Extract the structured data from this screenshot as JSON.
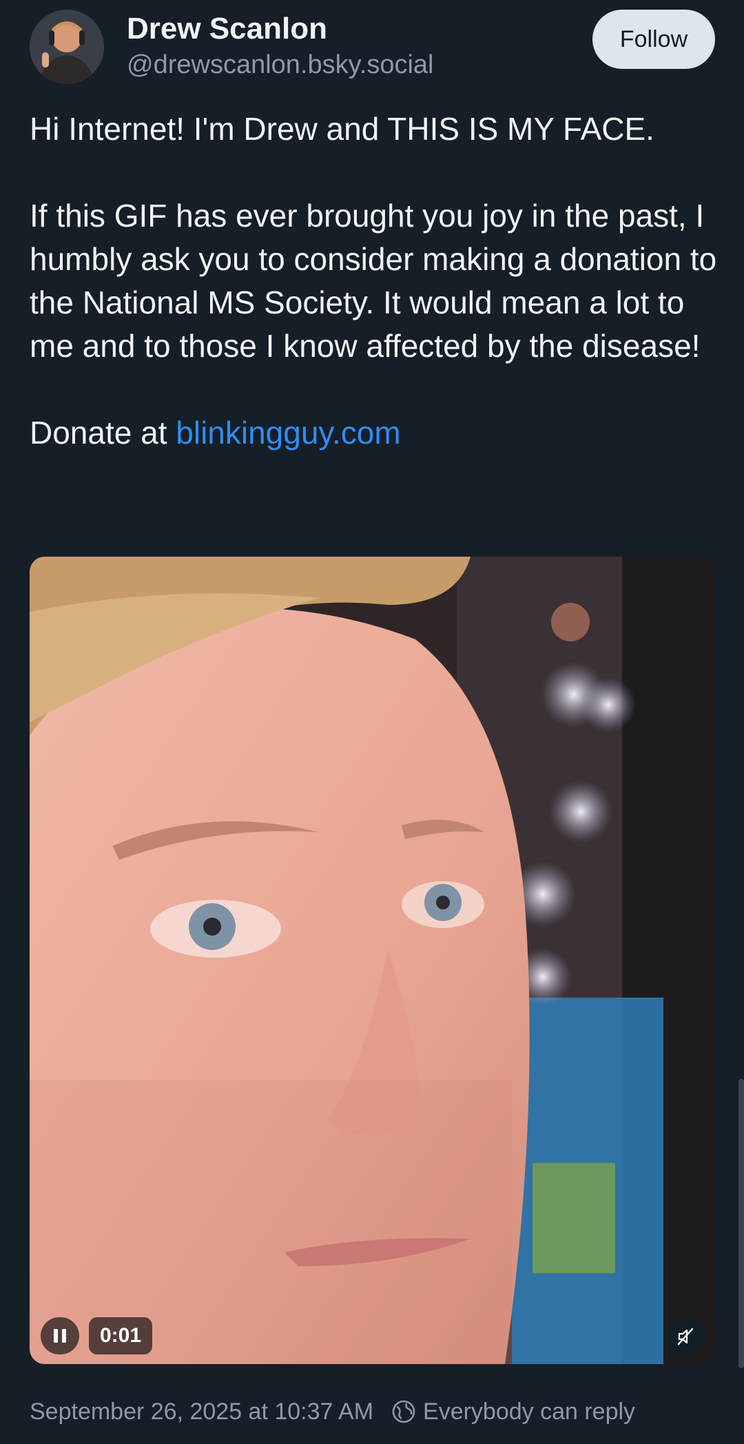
{
  "author": {
    "display_name": "Drew Scanlon",
    "handle": "@drewscanlon.bsky.social",
    "avatar_icon": "avatar-photo"
  },
  "actions": {
    "follow_label": "Follow"
  },
  "post": {
    "line1": "Hi Internet! I'm Drew and THIS IS MY FACE.",
    "line2": "If this GIF has ever brought you joy in the past, I humbly ask you to consider making a donation to the National MS Society. It would mean a lot to me and to those I know affected by the disease!",
    "donate_prefix": "Donate at ",
    "donate_link": "blinkingguy.com"
  },
  "media": {
    "time": "0:01",
    "pause_icon": "pause-icon",
    "mute_icon": "muted-speaker-icon"
  },
  "footer": {
    "timestamp": "September 26, 2025 at 10:37 AM",
    "reply_setting": "Everybody can reply",
    "reply_icon": "globe-icon"
  },
  "colors": {
    "background": "#161e27",
    "link": "#2f8cf4",
    "muted_text": "#8c9aab",
    "follow_button": "#dfe5ec"
  }
}
